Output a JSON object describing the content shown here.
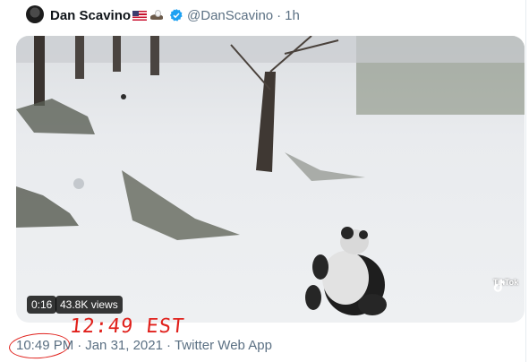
{
  "tweet": {
    "author_name": "Dan Scavino",
    "handle": "@DanScavino",
    "time_ago": "1h",
    "separator": "·",
    "verified": true,
    "flag_icon": "us-flag-icon",
    "extra_icon": "eagle-icon"
  },
  "video": {
    "duration": "0:16",
    "views": "43.8K views",
    "watermark": "TikTok",
    "watermark_sub": "@..."
  },
  "footer": {
    "time": "10:49 PM",
    "date": "Jan 31, 2021",
    "source": "Twitter Web App",
    "separator": "·"
  },
  "annotation": {
    "text": "12:49 EST",
    "color": "#e0201b"
  },
  "colors": {
    "name": "#0f1419",
    "secondary": "#5b7083",
    "verified": "#1da1f2"
  }
}
